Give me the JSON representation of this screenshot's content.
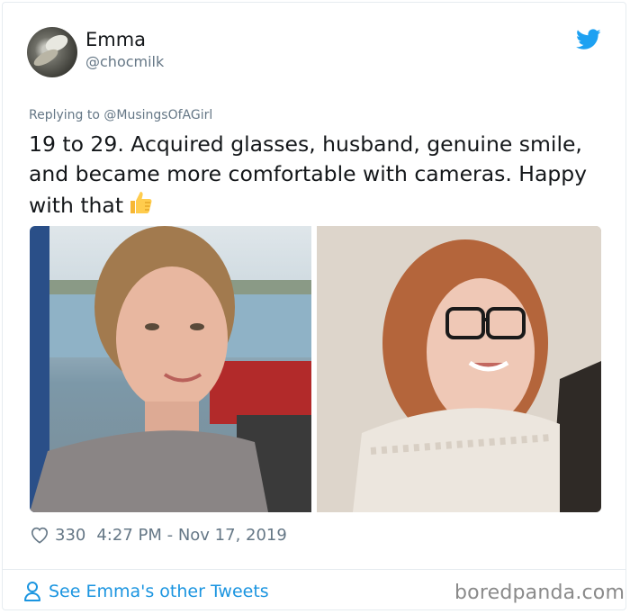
{
  "tweet": {
    "author_name": "Emma",
    "author_handle": "@chocmilk",
    "replying_prefix": "Replying to",
    "replying_to": "@MusingsOfAGirl",
    "text": "19 to 29. Acquired glasses, husband, genuine smile, and became more comfortable with cameras. Happy with that",
    "emoji": "thumbs-up-icon",
    "likes": "330",
    "timestamp": "4:27 PM - Nov 17, 2019"
  },
  "footer": {
    "see_more_label": "See Emma's other Tweets",
    "watermark": "boredpanda.com"
  },
  "colors": {
    "text": "#14171a",
    "secondary": "#657786",
    "link": "#1b95e0",
    "twitter_blue": "#1da1f2",
    "border": "#e6ecf0"
  }
}
